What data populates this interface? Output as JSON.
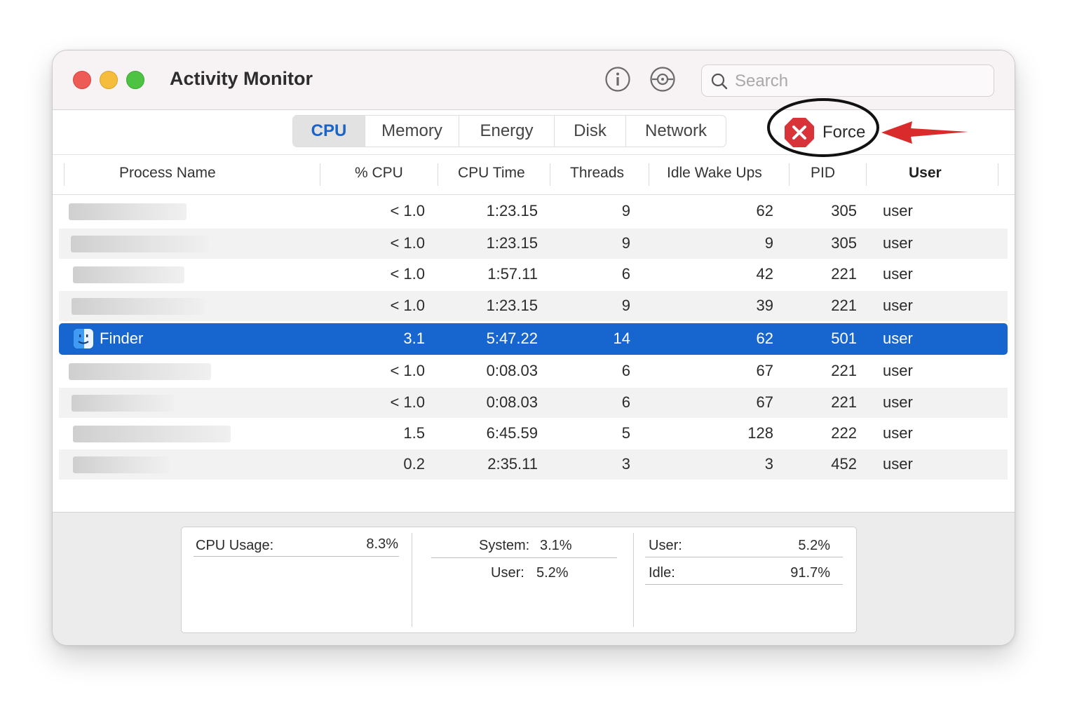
{
  "window": {
    "title": "Activity Monitor"
  },
  "search": {
    "placeholder": "Search"
  },
  "tabs": [
    "CPU",
    "Memory",
    "Energy",
    "Disk",
    "Network"
  ],
  "active_tab": "CPU",
  "force_quit": {
    "label": "Force"
  },
  "columns": [
    "Process Name",
    "% CPU",
    "CPU Time",
    "Threads",
    "Idle Wake Ups",
    "PID",
    "User"
  ],
  "processes": [
    {
      "name": "",
      "redacted": true,
      "cpu": "< 1.0",
      "cpu_time": "1:23.15",
      "threads": "9",
      "idle_wake_ups": "62",
      "pid": "305",
      "user": "user"
    },
    {
      "name": "",
      "redacted": true,
      "cpu": "< 1.0",
      "cpu_time": "1:23.15",
      "threads": "9",
      "idle_wake_ups": "9",
      "pid": "305",
      "user": "user"
    },
    {
      "name": "",
      "redacted": true,
      "cpu": "< 1.0",
      "cpu_time": "1:57.11",
      "threads": "6",
      "idle_wake_ups": "42",
      "pid": "221",
      "user": "user"
    },
    {
      "name": "",
      "redacted": true,
      "cpu": "< 1.0",
      "cpu_time": "1:23.15",
      "threads": "9",
      "idle_wake_ups": "39",
      "pid": "221",
      "user": "user"
    },
    {
      "name": "Finder",
      "redacted": false,
      "selected": true,
      "icon": "finder-icon",
      "cpu": "3.1",
      "cpu_time": "5:47.22",
      "threads": "14",
      "idle_wake_ups": "62",
      "pid": "501",
      "user": "user"
    },
    {
      "name": "",
      "redacted": true,
      "cpu": "< 1.0",
      "cpu_time": "0:08.03",
      "threads": "6",
      "idle_wake_ups": "67",
      "pid": "221",
      "user": "user"
    },
    {
      "name": "",
      "redacted": true,
      "cpu": "< 1.0",
      "cpu_time": "0:08.03",
      "threads": "6",
      "idle_wake_ups": "67",
      "pid": "221",
      "user": "user"
    },
    {
      "name": "",
      "redacted": true,
      "cpu": "1.5",
      "cpu_time": "6:45.59",
      "threads": "5",
      "idle_wake_ups": "128",
      "pid": "222",
      "user": "user"
    },
    {
      "name": "",
      "redacted": true,
      "cpu": "0.2",
      "cpu_time": "2:35.11",
      "threads": "3",
      "idle_wake_ups": "3",
      "pid": "452",
      "user": "user"
    }
  ],
  "summary": {
    "cpu_usage_label": "CPU Usage:",
    "cpu_usage_value": "8.3%",
    "system_label": "System:",
    "system_value": "3.1%",
    "user_label": "User:",
    "user_value": "5.2%",
    "user2_label": "User:",
    "user2_value": "5.2%",
    "idle_label": "Idle:",
    "idle_value": "91.7%"
  },
  "colors": {
    "selection": "#1766cf",
    "active_tab_text": "#1a63c9",
    "force_icon": "#d9333a",
    "annotation_ring": "#111111",
    "annotation_arrow": "#d92b2b"
  },
  "icons": [
    "info-icon",
    "inspect-icon",
    "search-icon",
    "force-quit-icon",
    "finder-icon"
  ]
}
